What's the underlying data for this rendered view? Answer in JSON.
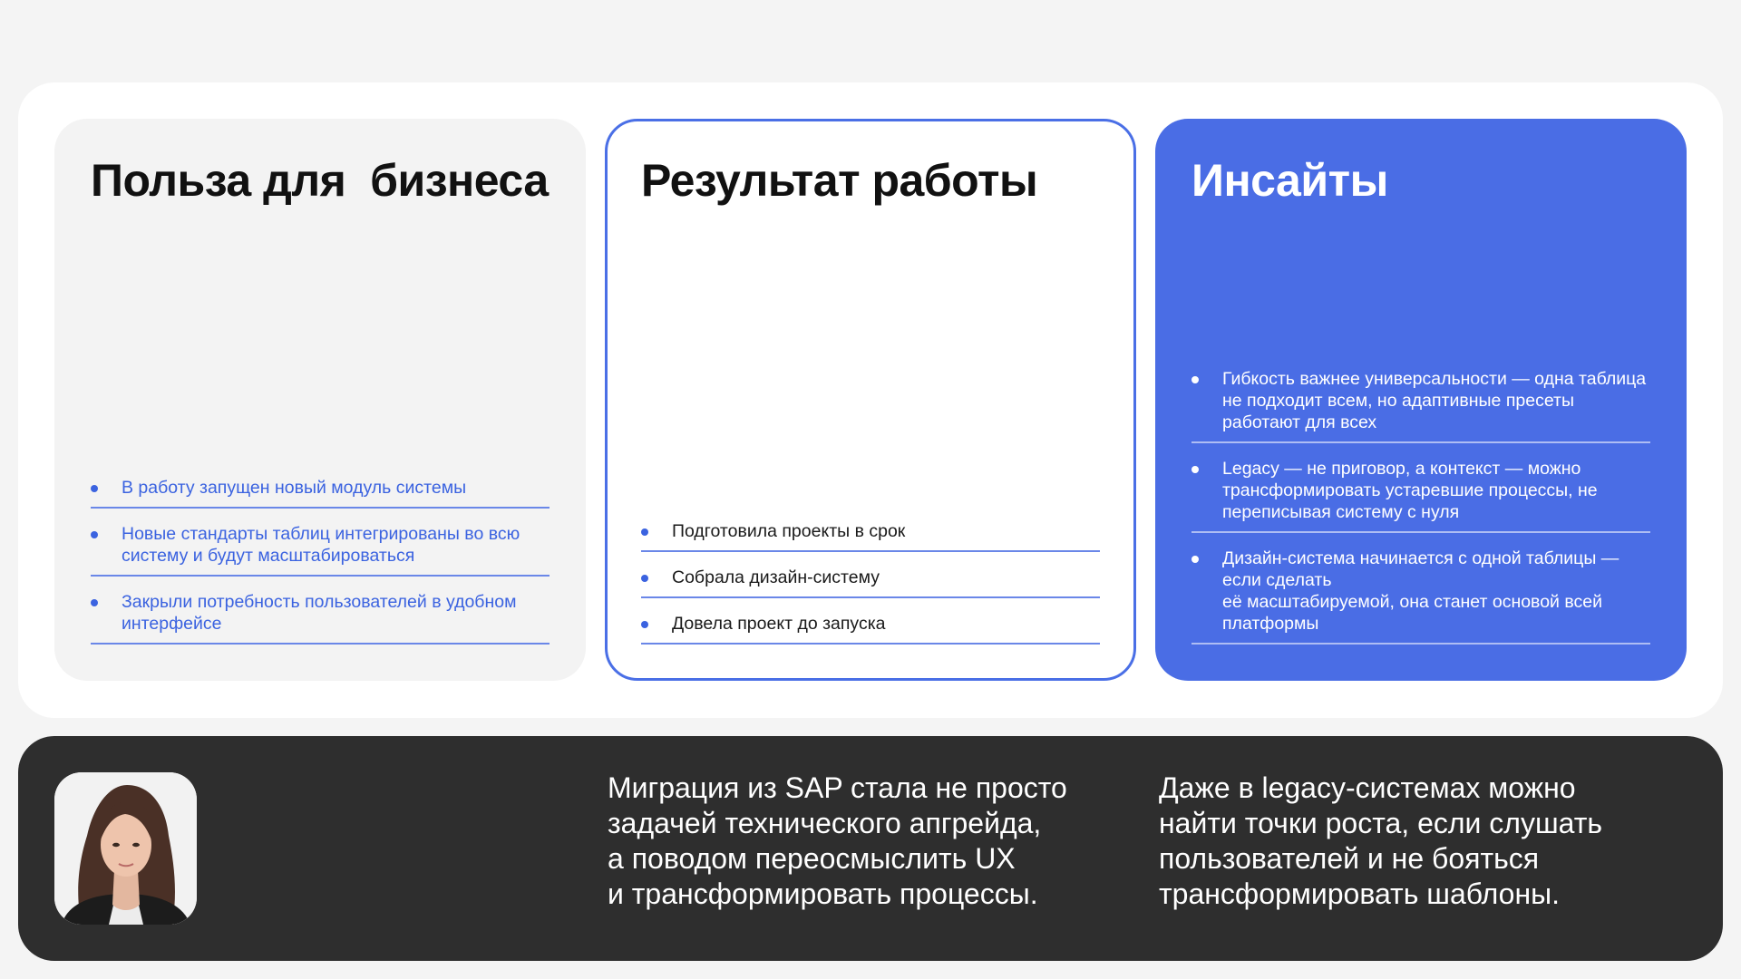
{
  "business": {
    "title": "Польза для  бизнеса",
    "items": [
      "В работу запущен новый модуль системы",
      "Новые стандарты таблиц интегрированы во всю систему и будут масштабироваться",
      "Закрыли потребность пользователей в удобном интерфейсе"
    ]
  },
  "result": {
    "title": "Результат работы",
    "items": [
      "Подготовила проекты в срок",
      "Собрала дизайн-систему",
      "Довела проект до запуска"
    ]
  },
  "insights": {
    "title": "Инсайты",
    "items": [
      "Гибкость важнее универсальности — одна таблица не подходит всем, но адаптивные пресеты работают для всех",
      "Legacy — не приговор, а контекст — можно трансформировать устаревшие процессы, не переписывая систему с нуля",
      "Дизайн-система начинается с одной таблицы — если сделать\nеё масштабируемой, она станет основой всей платформы"
    ]
  },
  "footer": {
    "quote_1": "Миграция из SAP стала не просто\nзадачей технического апгрейда,\nа поводом переосмыслить UX\nи трансформировать процессы.",
    "quote_2": "Даже в legacy-системах можно\nнайти точки роста, если слушать\nпользователей и не бояться\nтрансформировать шаблоны."
  },
  "colors": {
    "accent": "#4a6de5",
    "dark_panel": "#2e2e2e",
    "light_card": "#f3f3f3"
  }
}
